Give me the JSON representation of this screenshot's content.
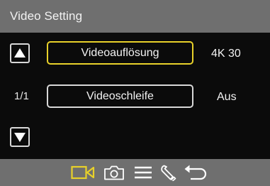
{
  "header": {
    "title": "Video Setting"
  },
  "nav": {
    "up_icon": "arrow-up-icon",
    "down_icon": "arrow-down-icon",
    "page": "1/1"
  },
  "settings": [
    {
      "label": "Videoauflösung",
      "value": "4K 30",
      "selected": true
    },
    {
      "label": "Videoschleife",
      "value": "Aus",
      "selected": false
    }
  ],
  "tabs": [
    {
      "icon": "video-camera-icon",
      "active": true
    },
    {
      "icon": "camera-icon",
      "active": false
    },
    {
      "icon": "menu-icon",
      "active": false
    },
    {
      "icon": "wrench-icon",
      "active": false
    },
    {
      "icon": "back-arrow-icon",
      "active": false
    }
  ],
  "colors": {
    "bar_background": "#6f6f6f",
    "screen_background": "#0b0b0b",
    "selection_accent": "#e8d12a",
    "inactive_icon": "#ffffff"
  }
}
